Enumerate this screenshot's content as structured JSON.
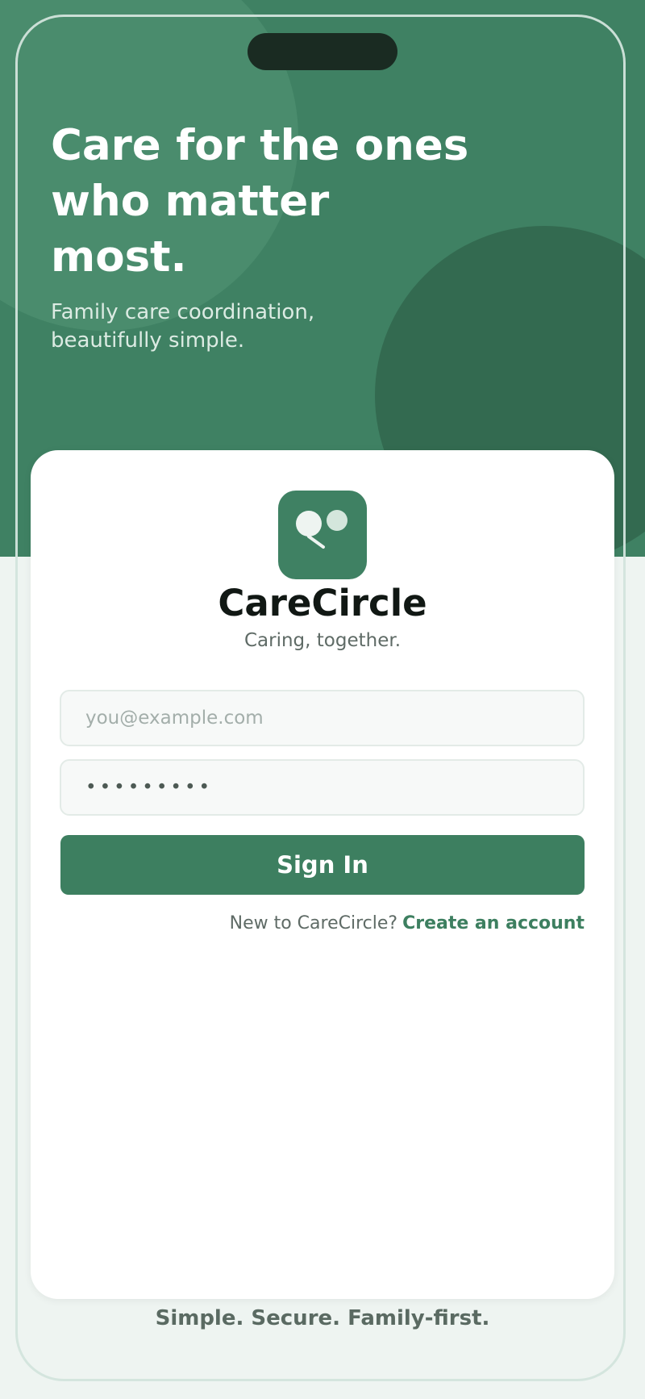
{
  "hero": {
    "title": "Care for the ones who matter most.",
    "subtitle": "Family care coordination, beautifully simple."
  },
  "brand": {
    "logo_icon": "chat-bubbles-icon",
    "name": "CareCircle",
    "tagline": "Caring, together."
  },
  "form": {
    "email_placeholder": "you@example.com",
    "email_value": "",
    "password_value": "•••••••••",
    "signin_label": "Sign In"
  },
  "signup": {
    "prompt": "New to CareCircle?",
    "link": "Create an account"
  },
  "footer": {
    "text": "Simple. Secure. Family-first."
  },
  "colors": {
    "primary": "#3f8163",
    "hero_dark": "#336a50",
    "background": "#eef4f1",
    "card": "#ffffff"
  }
}
